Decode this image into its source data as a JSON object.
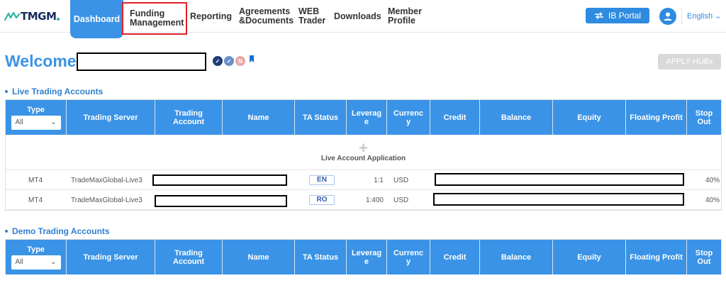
{
  "brand": {
    "logo_text": "TMGM",
    "accent": "#3a93e6",
    "highlight_border": "#e0202a"
  },
  "nav": {
    "dashboard": "Dashboard",
    "funding_line1": "Funding",
    "funding_line2": "Management",
    "reporting": "Reporting",
    "agreements_line1": "Agreements",
    "agreements_line2": "&Documents",
    "web_line1": "WEB",
    "web_line2": "Trader",
    "downloads": "Downloads",
    "member_line1": "Member",
    "member_line2": "Profile",
    "ib_portal": "IB Portal",
    "language": "English"
  },
  "welcome": {
    "text": "Welcome,",
    "badge_n": "N",
    "apply_button": "APPLY HUBx"
  },
  "live": {
    "title": "Live Trading Accounts",
    "empty_action": "Live Account Application",
    "rows": [
      {
        "type": "MT4",
        "server": "TradeMaxGlobal-Live3",
        "ta_status": "EN",
        "leverage": "1:1",
        "currency": "USD",
        "stop_out": "40%"
      },
      {
        "type": "MT4",
        "server": "TradeMaxGlobal-Live3",
        "ta_status": "RO",
        "leverage": "1:400",
        "currency": "USD",
        "stop_out": "40%"
      }
    ]
  },
  "demo": {
    "title": "Demo Trading Accounts"
  },
  "table_headers": {
    "type": "Type",
    "type_filter": "All",
    "server": "Trading Server",
    "account_l1": "Trading",
    "account_l2": "Account",
    "name": "Name",
    "ta_status": "TA Status",
    "leverage_l1": "Leverag",
    "leverage_l2": "e",
    "currency_l1": "Currenc",
    "currency_l2": "y",
    "credit": "Credit",
    "balance": "Balance",
    "equity": "Equity",
    "floating": "Floating Profit",
    "stop_l1": "Stop",
    "stop_l2": "Out"
  }
}
